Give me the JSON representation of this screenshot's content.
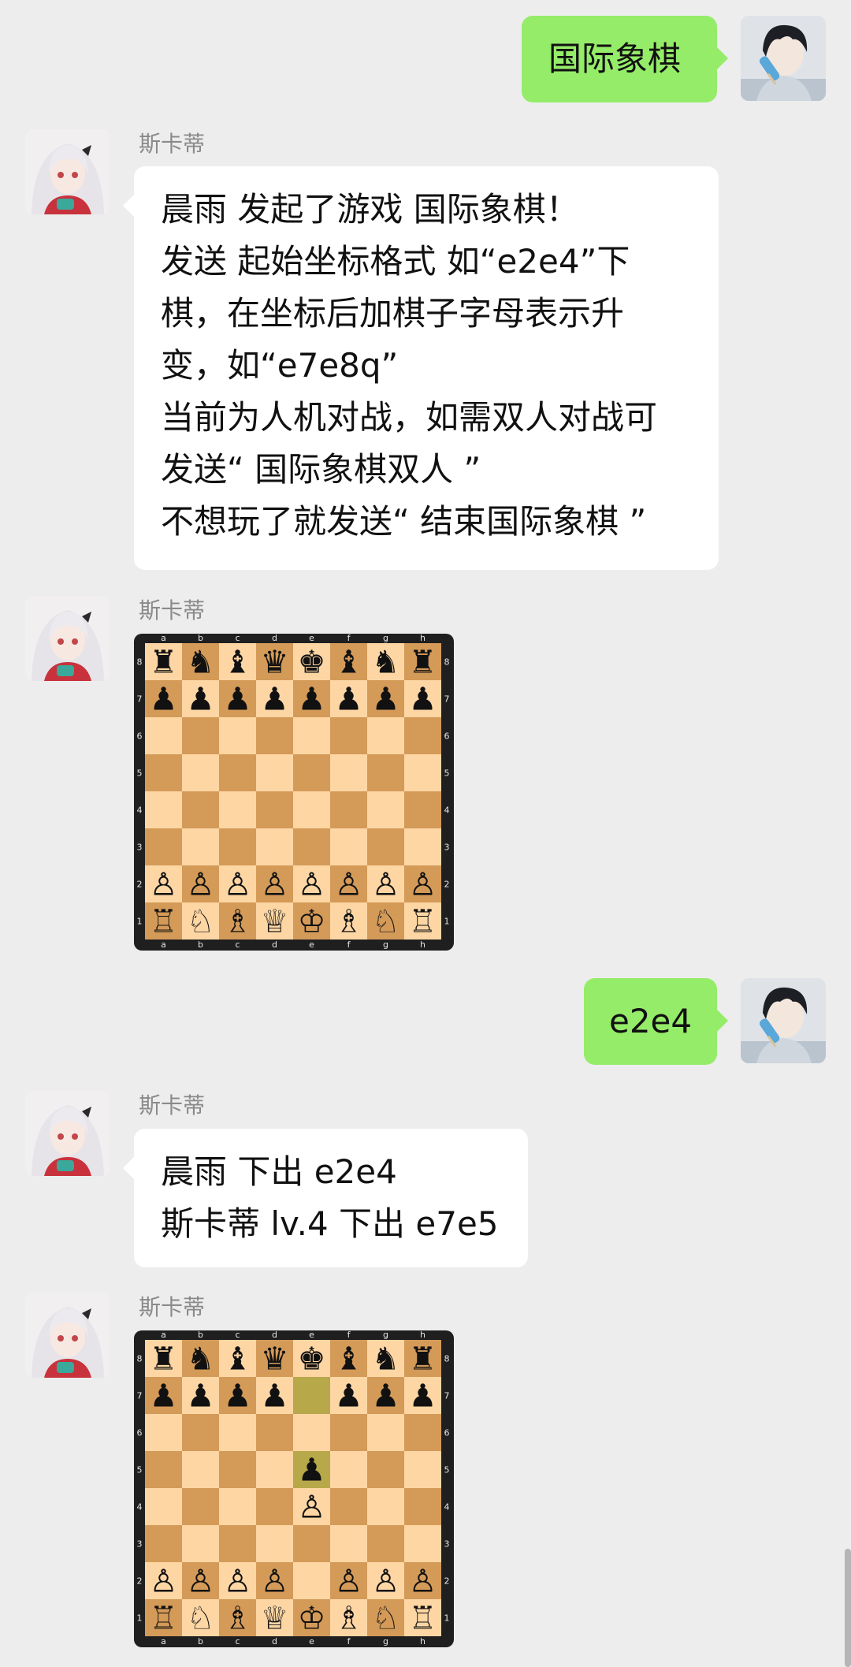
{
  "me": {
    "name": "晨雨"
  },
  "bot": {
    "name": "斯卡蒂"
  },
  "messages": [
    {
      "kind": "text",
      "side": "right",
      "lines": [
        "国际象棋"
      ]
    },
    {
      "kind": "text",
      "side": "left",
      "sender": "斯卡蒂",
      "lines": [
        "晨雨 发起了游戏 国际象棋！",
        "发送 起始坐标格式 如“e2e4”下",
        "棋，在坐标后加棋子字母表示升",
        "变，如“e7e8q”",
        "当前为人机对战，如需双人对战可",
        "发送“ 国际象棋双人 ”",
        "不想玩了就发送“ 结束国际象棋 ”"
      ]
    },
    {
      "kind": "board",
      "side": "left",
      "sender": "斯卡蒂"
    },
    {
      "kind": "text",
      "side": "right",
      "lines": [
        "e2e4"
      ]
    },
    {
      "kind": "text",
      "side": "left",
      "sender": "斯卡蒂",
      "lines": [
        "晨雨 下出 e2e4",
        "斯卡蒂 lv.4 下出 e7e5"
      ]
    },
    {
      "kind": "board",
      "side": "left",
      "sender": "斯卡蒂"
    }
  ],
  "boards": [
    {
      "files": [
        "a",
        "b",
        "c",
        "d",
        "e",
        "f",
        "g",
        "h"
      ],
      "ranks": [
        "8",
        "7",
        "6",
        "5",
        "4",
        "3",
        "2",
        "1"
      ],
      "position": [
        "rnbqkbnr",
        "pppppppp",
        "8",
        "8",
        "8",
        "8",
        "PPPPPPPP",
        "RNBQKBNR"
      ],
      "highlight": []
    },
    {
      "files": [
        "a",
        "b",
        "c",
        "d",
        "e",
        "f",
        "g",
        "h"
      ],
      "ranks": [
        "8",
        "7",
        "6",
        "5",
        "4",
        "3",
        "2",
        "1"
      ],
      "position": [
        "rnbqkbnr",
        "pppp1ppp",
        "8",
        "4p3",
        "4P3",
        "8",
        "PPPP1PPP",
        "RNBQKBNR"
      ],
      "highlight": [
        "e7",
        "e5"
      ]
    }
  ],
  "colors": {
    "background": "#ededed",
    "bubble_left": "#ffffff",
    "bubble_right": "#95ec69",
    "square_light": "#fdd6a4",
    "square_dark": "#d49a58",
    "highlight": "#b7a84a",
    "board_frame": "#1f1f1f"
  },
  "icons": {
    "me_avatar": "anime-boy-popsicle-avatar",
    "bot_avatar": "anime-girl-white-hair-avatar"
  }
}
